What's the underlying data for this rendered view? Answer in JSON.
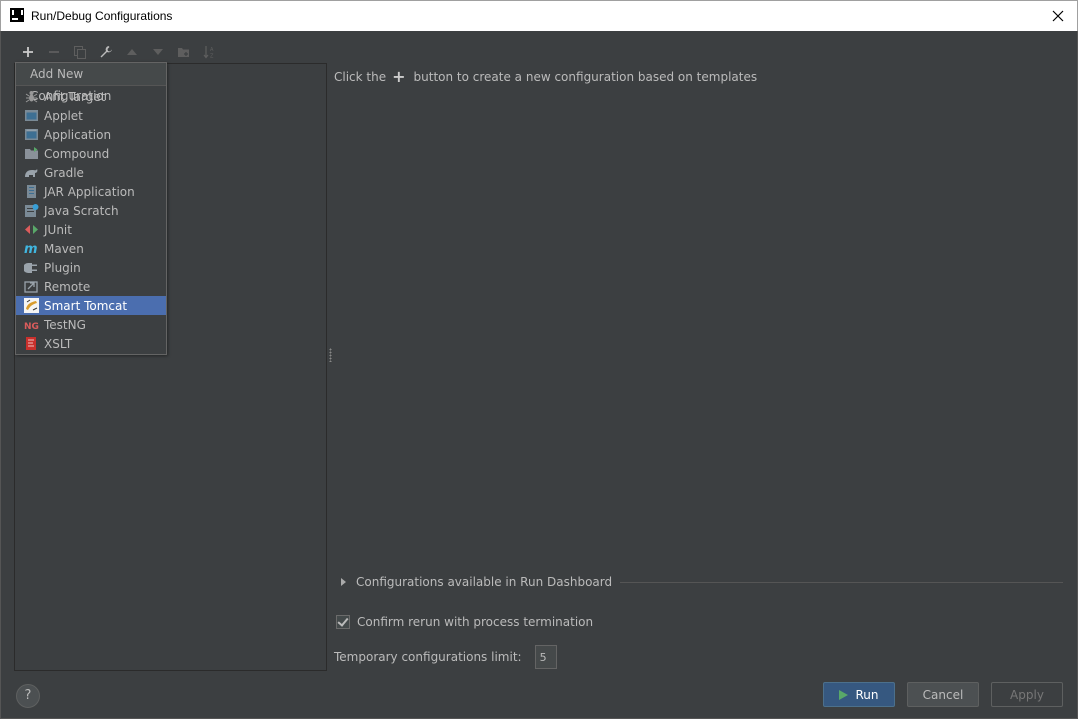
{
  "window": {
    "title": "Run/Debug Configurations"
  },
  "toolbar": {
    "buttons": [
      "add-icon",
      "remove-icon",
      "copy-icon",
      "wrench-icon",
      "move-up-icon",
      "move-down-icon",
      "folder-icon",
      "sort-icon"
    ]
  },
  "popup": {
    "header": "Add New Configuration",
    "items": [
      {
        "label": "Ant Target",
        "icon": "ant-icon"
      },
      {
        "label": "Applet",
        "icon": "applet-icon"
      },
      {
        "label": "Application",
        "icon": "application-icon"
      },
      {
        "label": "Compound",
        "icon": "compound-icon"
      },
      {
        "label": "Gradle",
        "icon": "gradle-icon"
      },
      {
        "label": "JAR Application",
        "icon": "jar-icon"
      },
      {
        "label": "Java Scratch",
        "icon": "java-scratch-icon"
      },
      {
        "label": "JUnit",
        "icon": "junit-icon"
      },
      {
        "label": "Maven",
        "icon": "maven-icon"
      },
      {
        "label": "Plugin",
        "icon": "plugin-icon"
      },
      {
        "label": "Remote",
        "icon": "remote-icon"
      },
      {
        "label": "Smart Tomcat",
        "icon": "tomcat-icon",
        "selected": true
      },
      {
        "label": "TestNG",
        "icon": "testng-icon"
      },
      {
        "label": "XSLT",
        "icon": "xslt-icon"
      }
    ]
  },
  "main": {
    "hint_before": "Click the",
    "hint_after": "button to create a new configuration based on templates",
    "dashboard_label": "Configurations available in Run Dashboard",
    "confirm_label": "Confirm rerun with process termination",
    "confirm_checked": true,
    "temp_limit_label": "Temporary configurations limit:",
    "temp_limit_value": "5"
  },
  "footer": {
    "help_label": "?",
    "run_label": "Run",
    "cancel_label": "Cancel",
    "apply_label": "Apply"
  },
  "colors": {
    "background": "#3c3f41",
    "selection": "#4b6eaf",
    "run_button": "#365880",
    "text": "#bbbbbb"
  }
}
